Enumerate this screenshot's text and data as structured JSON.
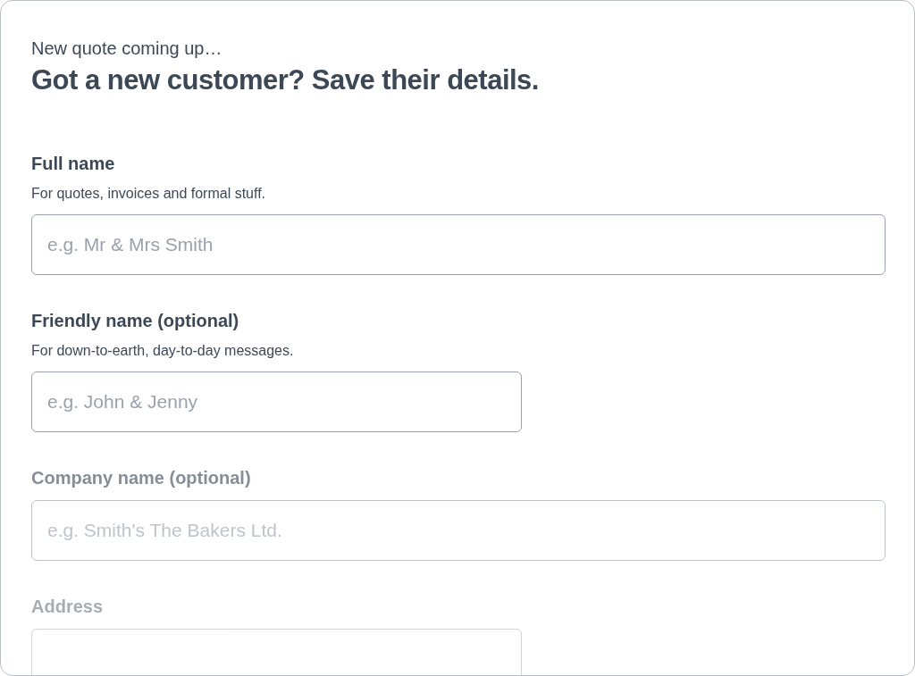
{
  "intro": "New quote coming up…",
  "heading": "Got a new customer? Save their details.",
  "fields": [
    {
      "label": "Full name",
      "hint": "For quotes, invoices and formal stuff.",
      "placeholder": "e.g. Mr & Mrs Smith",
      "kind": "wide"
    },
    {
      "label": "Friendly name (optional)",
      "hint": "For down-to-earth, day-to-day messages.",
      "placeholder": "e.g. John & Jenny",
      "kind": "narrow"
    },
    {
      "label": "Company name (optional)",
      "placeholder": "e.g. Smith's The Bakers Ltd.",
      "kind": "wide"
    },
    {
      "label": "Address",
      "kind": "narrow"
    }
  ]
}
